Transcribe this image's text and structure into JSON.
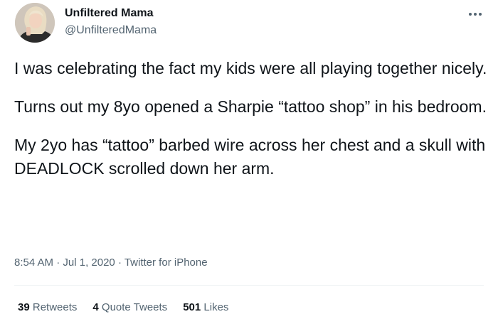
{
  "author": {
    "display_name": "Unfiltered Mama",
    "handle": "@UnfilteredMama",
    "avatar_icon": "profile-photo"
  },
  "more_icon": "more-horizontal-icon",
  "tweet": {
    "paragraphs": [
      "I was celebrating the fact my kids were all playing together nicely.",
      "Turns out my 8yo opened a Sharpie “tattoo shop” in his bedroom.",
      "My 2yo has “tattoo” barbed wire across her chest and a skull with DEADLOCK scrolled down her arm."
    ]
  },
  "meta": {
    "time": "8:54 AM",
    "separator": " · ",
    "date": "Jul 1, 2020",
    "source": "Twitter for iPhone"
  },
  "stats": {
    "retweets_count": "39",
    "retweets_label": "Retweets",
    "quotes_count": "4",
    "quotes_label": "Quote Tweets",
    "likes_count": "501",
    "likes_label": "Likes"
  },
  "colors": {
    "text_primary": "#0f1419",
    "text_secondary": "#536471",
    "divider": "#eff3f4"
  }
}
